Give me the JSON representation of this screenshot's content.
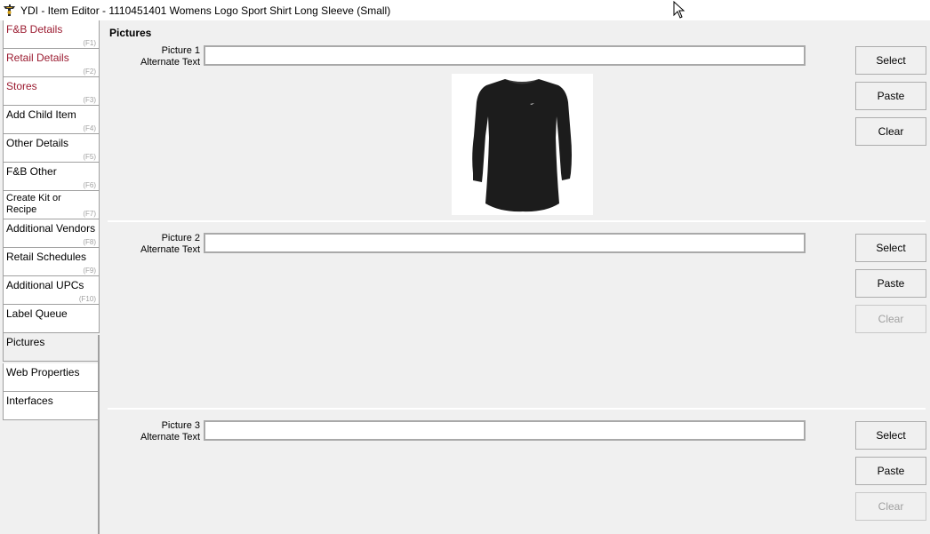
{
  "window": {
    "title": "YDI - Item Editor - 1110451401 Womens Logo Sport Shirt Long Sleeve (Small)",
    "app_icon": "ydi-app-icon",
    "cursor": "mouse-pointer-icon"
  },
  "sidebar": {
    "tabs": [
      {
        "label": "F&B Details",
        "key": "(F1)"
      },
      {
        "label": "Retail Details",
        "key": "(F2)"
      },
      {
        "label": "Stores",
        "key": "(F3)"
      },
      {
        "label": "Add Child Item",
        "key": "(F4)"
      },
      {
        "label": "Other Details",
        "key": "(F5)"
      },
      {
        "label": "F&B Other",
        "key": "(F6)"
      },
      {
        "label": "Create Kit or Recipe",
        "key": "(F7)"
      },
      {
        "label": "Additional Vendors",
        "key": "(F8)"
      },
      {
        "label": "Retail Schedules",
        "key": "(F9)"
      },
      {
        "label": "Additional UPCs",
        "key": "(F10)"
      },
      {
        "label": "Label Queue",
        "key": ""
      },
      {
        "label": "Pictures",
        "key": ""
      },
      {
        "label": "Web Properties",
        "key": ""
      },
      {
        "label": "Interfaces",
        "key": ""
      }
    ],
    "active_tab": "Pictures",
    "highlight_color": "#9b1b30"
  },
  "main": {
    "section_title": "Pictures",
    "pictures": [
      {
        "label": "Picture 1",
        "alt_label": "Alternate Text",
        "value": "",
        "image": "black-long-sleeve-shirt",
        "select": "Select",
        "paste": "Paste",
        "clear": "Clear",
        "clear_enabled": true
      },
      {
        "label": "Picture 2",
        "alt_label": "Alternate Text",
        "value": "",
        "select": "Select",
        "paste": "Paste",
        "clear": "Clear",
        "clear_enabled": false
      },
      {
        "label": "Picture 3",
        "alt_label": "Alternate Text",
        "value": "",
        "select": "Select",
        "paste": "Paste",
        "clear": "Clear",
        "clear_enabled": false
      }
    ]
  }
}
